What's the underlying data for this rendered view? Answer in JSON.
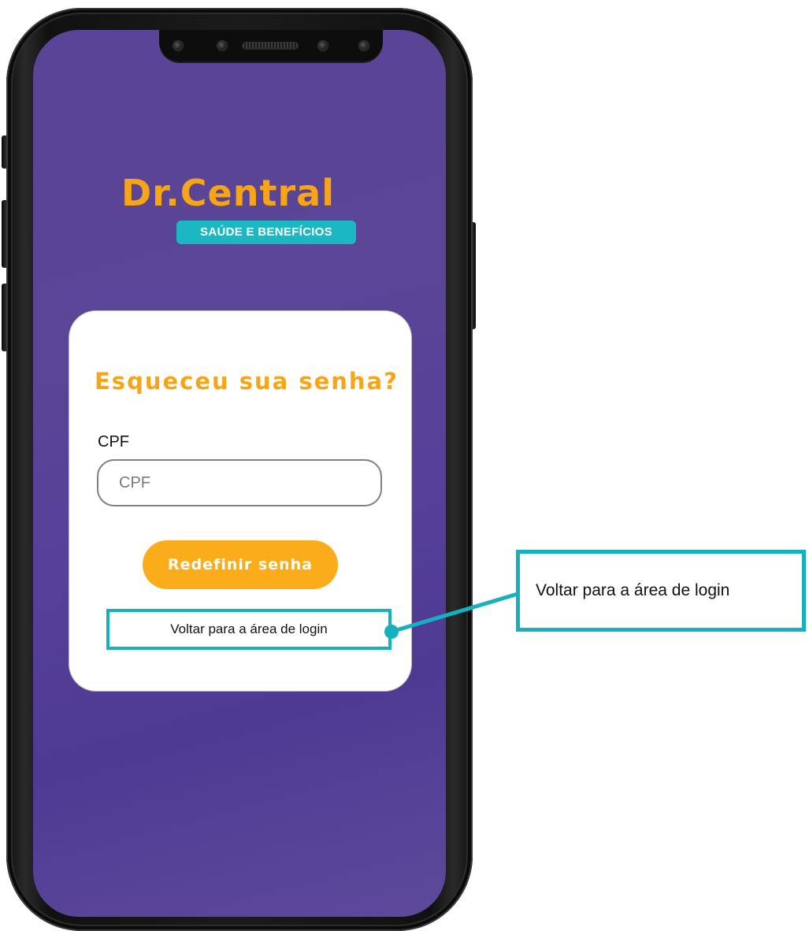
{
  "logo": {
    "title": "Dr.Central",
    "tagline": "SAÚDE E BENEFÍCIOS"
  },
  "form": {
    "title": "Esqueceu sua senha?",
    "cpf_label": "CPF",
    "cpf_placeholder": "CPF",
    "cpf_value": "",
    "submit_label": "Redefinir senha",
    "back_link_label": "Voltar para a área de login"
  },
  "annotation": {
    "text": "Voltar para a área de login"
  },
  "colors": {
    "background_purple": "#5a4497",
    "brand_orange": "#f7a516",
    "button_orange": "#fbac1b",
    "tagline_teal": "#1bb8c4",
    "annotation_teal": "#17b0bf"
  }
}
